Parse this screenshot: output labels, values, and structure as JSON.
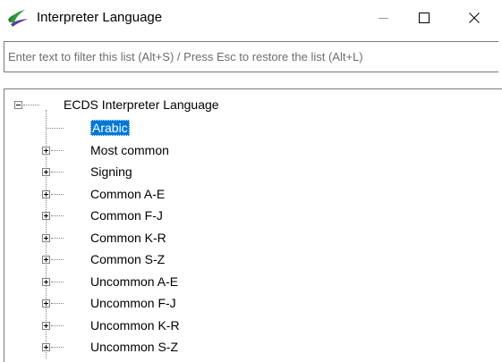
{
  "window": {
    "title": "Interpreter Language",
    "app_icon": "green-swoosh-icon",
    "controls": {
      "minimize": "minimize-icon",
      "maximize": "maximize-icon",
      "close": "close-icon"
    }
  },
  "filter": {
    "placeholder": "Enter text to filter this list (Alt+S) / Press Esc to restore the list (Alt+L)",
    "value": ""
  },
  "tree": {
    "root": {
      "label": "ECDS Interpreter Language",
      "expanded": true
    },
    "items": [
      {
        "label": "Arabic",
        "selected": true,
        "expandable": false
      },
      {
        "label": "Most common",
        "selected": false,
        "expandable": true
      },
      {
        "label": "Signing",
        "selected": false,
        "expandable": true
      },
      {
        "label": "Common A-E",
        "selected": false,
        "expandable": true
      },
      {
        "label": "Common F-J",
        "selected": false,
        "expandable": true
      },
      {
        "label": "Common K-R",
        "selected": false,
        "expandable": true
      },
      {
        "label": "Common S-Z",
        "selected": false,
        "expandable": true
      },
      {
        "label": "Uncommon A-E",
        "selected": false,
        "expandable": true
      },
      {
        "label": "Uncommon F-J",
        "selected": false,
        "expandable": true
      },
      {
        "label": "Uncommon K-R",
        "selected": false,
        "expandable": true
      },
      {
        "label": "Uncommon S-Z",
        "selected": false,
        "expandable": true
      }
    ]
  },
  "colors": {
    "selection": "#0078d7",
    "tree_lines": "#808080",
    "border": "#7a7a7a"
  }
}
